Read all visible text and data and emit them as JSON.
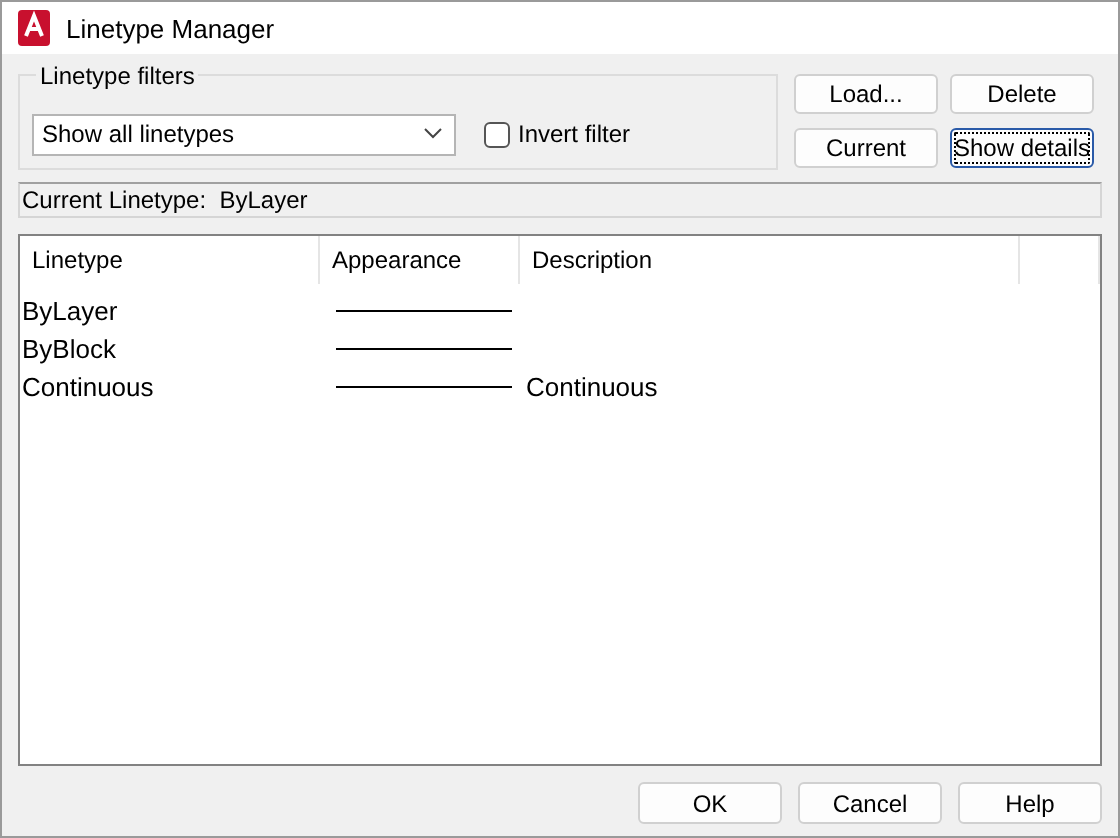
{
  "window": {
    "title": "Linetype Manager"
  },
  "filters": {
    "label": "Linetype filters",
    "dropdown": "Show all linetypes",
    "invert_filter": {
      "label": "Invert filter",
      "checked": false
    }
  },
  "side_buttons": [
    {
      "label": "Load...",
      "focused": false
    },
    {
      "label": "Delete",
      "focused": false
    },
    {
      "label": "Current",
      "focused": false
    },
    {
      "label": "Show details",
      "focused": true
    }
  ],
  "current_linetype": {
    "label": "Current Linetype:",
    "value": "ByLayer"
  },
  "table": {
    "columns": [
      "Linetype",
      "Appearance",
      "Description"
    ],
    "rows": [
      {
        "linetype": "ByLayer",
        "selected": false
      },
      {
        "linetype": "ByBlock",
        "selected": false
      },
      {
        "linetype": "Continuous",
        "description": "Continuous",
        "selected": false
      }
    ]
  },
  "buttons": [
    {
      "label": "OK"
    },
    {
      "label": "Cancel"
    },
    {
      "label": "Help"
    }
  ]
}
